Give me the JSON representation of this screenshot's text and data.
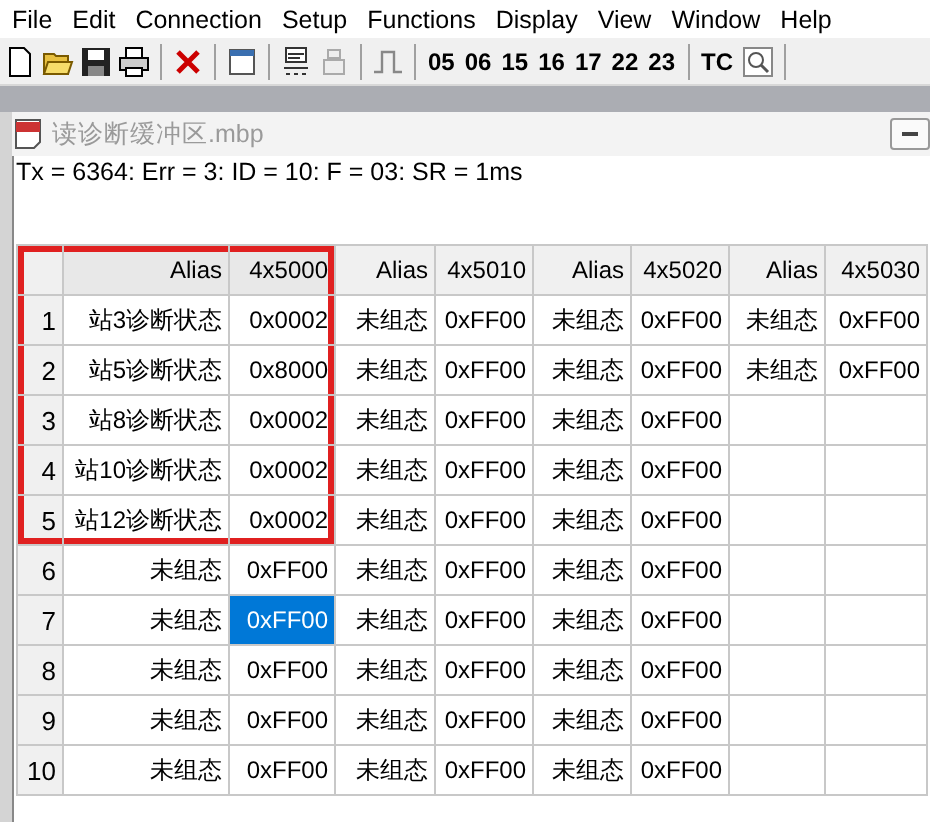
{
  "menu": [
    "File",
    "Edit",
    "Connection",
    "Setup",
    "Functions",
    "Display",
    "View",
    "Window",
    "Help"
  ],
  "toolbar": {
    "function_codes": [
      "05",
      "06",
      "15",
      "16",
      "17",
      "22",
      "23"
    ],
    "tc": "TC"
  },
  "document": {
    "title": "读诊断缓冲区.mbp",
    "status": "Tx = 6364: Err = 3: ID = 10: F = 03: SR = 1ms"
  },
  "table": {
    "columns": [
      {
        "label": "Alias",
        "highlighted": true
      },
      {
        "label": "4x5000",
        "highlighted": true
      },
      {
        "label": "Alias",
        "highlighted": false
      },
      {
        "label": "4x5010",
        "highlighted": false
      },
      {
        "label": "Alias",
        "highlighted": false
      },
      {
        "label": "4x5020",
        "highlighted": false
      },
      {
        "label": "Alias",
        "highlighted": false
      },
      {
        "label": "4x5030",
        "highlighted": false
      }
    ],
    "rows": [
      {
        "header": "1",
        "highlighted": true,
        "cells": [
          {
            "text": "站3诊断状态",
            "selected": false
          },
          {
            "text": "0x0002",
            "selected": false
          },
          {
            "text": "未组态",
            "selected": false
          },
          {
            "text": "0xFF00",
            "selected": false
          },
          {
            "text": "未组态",
            "selected": false
          },
          {
            "text": "0xFF00",
            "selected": false
          },
          {
            "text": "未组态",
            "selected": false
          },
          {
            "text": "0xFF00",
            "selected": false
          }
        ]
      },
      {
        "header": "2",
        "highlighted": true,
        "cells": [
          {
            "text": "站5诊断状态",
            "selected": false
          },
          {
            "text": "0x8000",
            "selected": false
          },
          {
            "text": "未组态",
            "selected": false
          },
          {
            "text": "0xFF00",
            "selected": false
          },
          {
            "text": "未组态",
            "selected": false
          },
          {
            "text": "0xFF00",
            "selected": false
          },
          {
            "text": "未组态",
            "selected": false
          },
          {
            "text": "0xFF00",
            "selected": false
          }
        ]
      },
      {
        "header": "3",
        "highlighted": true,
        "cells": [
          {
            "text": "站8诊断状态",
            "selected": false
          },
          {
            "text": "0x0002",
            "selected": false
          },
          {
            "text": "未组态",
            "selected": false
          },
          {
            "text": "0xFF00",
            "selected": false
          },
          {
            "text": "未组态",
            "selected": false
          },
          {
            "text": "0xFF00",
            "selected": false
          },
          {
            "selected": false
          },
          {
            "selected": false
          }
        ]
      },
      {
        "header": "4",
        "highlighted": true,
        "cells": [
          {
            "text": "站10诊断状态",
            "selected": false
          },
          {
            "text": "0x0002",
            "selected": false
          },
          {
            "text": "未组态",
            "selected": false
          },
          {
            "text": "0xFF00",
            "selected": false
          },
          {
            "text": "未组态",
            "selected": false
          },
          {
            "text": "0xFF00",
            "selected": false
          },
          {
            "selected": false
          },
          {
            "selected": false
          }
        ]
      },
      {
        "header": "5",
        "highlighted": true,
        "cells": [
          {
            "text": "站12诊断状态",
            "selected": false
          },
          {
            "text": "0x0002",
            "selected": false
          },
          {
            "text": "未组态",
            "selected": false
          },
          {
            "text": "0xFF00",
            "selected": false
          },
          {
            "text": "未组态",
            "selected": false
          },
          {
            "text": "0xFF00",
            "selected": false
          },
          {
            "selected": false
          },
          {
            "selected": false
          }
        ]
      },
      {
        "header": "6",
        "highlighted": false,
        "cells": [
          {
            "text": "未组态",
            "selected": false
          },
          {
            "text": "0xFF00",
            "selected": false
          },
          {
            "text": "未组态",
            "selected": false
          },
          {
            "text": "0xFF00",
            "selected": false
          },
          {
            "text": "未组态",
            "selected": false
          },
          {
            "text": "0xFF00",
            "selected": false
          },
          {
            "selected": false
          },
          {
            "selected": false
          }
        ]
      },
      {
        "header": "7",
        "highlighted": false,
        "cells": [
          {
            "text": "未组态",
            "selected": false
          },
          {
            "text": "0xFF00",
            "selected": true
          },
          {
            "text": "未组态",
            "selected": false
          },
          {
            "text": "0xFF00",
            "selected": false
          },
          {
            "text": "未组态",
            "selected": false
          },
          {
            "text": "0xFF00",
            "selected": false
          },
          {
            "selected": false
          },
          {
            "selected": false
          }
        ]
      },
      {
        "header": "8",
        "highlighted": false,
        "cells": [
          {
            "text": "未组态",
            "selected": false
          },
          {
            "text": "0xFF00",
            "selected": false
          },
          {
            "text": "未组态",
            "selected": false
          },
          {
            "text": "0xFF00",
            "selected": false
          },
          {
            "text": "未组态",
            "selected": false
          },
          {
            "text": "0xFF00",
            "selected": false
          },
          {
            "selected": false
          },
          {
            "selected": false
          }
        ]
      },
      {
        "header": "9",
        "highlighted": false,
        "cells": [
          {
            "text": "未组态",
            "selected": false
          },
          {
            "text": "0xFF00",
            "selected": false
          },
          {
            "text": "未组态",
            "selected": false
          },
          {
            "text": "0xFF00",
            "selected": false
          },
          {
            "text": "未组态",
            "selected": false
          },
          {
            "text": "0xFF00",
            "selected": false
          },
          {
            "selected": false
          },
          {
            "selected": false
          }
        ]
      },
      {
        "header": "10",
        "highlighted": false,
        "cells": [
          {
            "text": "未组态",
            "selected": false
          },
          {
            "text": "0xFF00",
            "selected": false
          },
          {
            "text": "未组态",
            "selected": false
          },
          {
            "text": "0xFF00",
            "selected": false
          },
          {
            "text": "未组态",
            "selected": false
          },
          {
            "text": "0xFF00",
            "selected": false
          },
          {
            "selected": false
          },
          {
            "selected": false
          }
        ]
      }
    ]
  }
}
